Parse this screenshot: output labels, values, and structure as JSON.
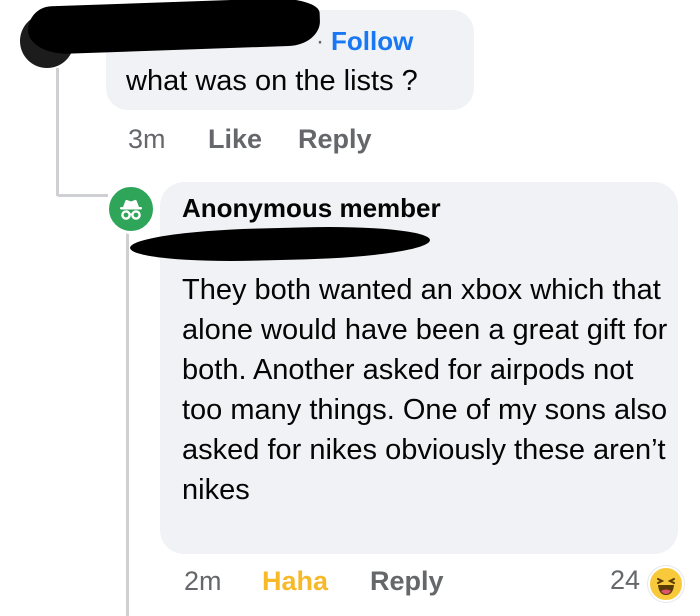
{
  "comments": [
    {
      "follow_separator": "·",
      "follow_label": "Follow",
      "text": "what was on the lists ?",
      "time": "3m",
      "like_label": "Like",
      "reply_label": "Reply"
    },
    {
      "author": "Anonymous member",
      "avatar_icon": "incognito-icon",
      "avatar_color": "#2fa559",
      "text": "They both wanted an xbox which that alone would have been a great gift for both. Another asked for airpods not too many things. One of my sons also asked for nikes obviously these aren’t nikes",
      "time": "2m",
      "reaction_label": "Haha",
      "reaction_color": "#f7b928",
      "reply_label": "Reply",
      "reaction_count": "24",
      "reaction_icon": "haha-emoji-icon"
    }
  ],
  "colors": {
    "link_blue": "#1877f2",
    "meta_gray": "#65676b",
    "bubble_bg": "#f0f2f5",
    "thread_line": "#ced0d4"
  }
}
